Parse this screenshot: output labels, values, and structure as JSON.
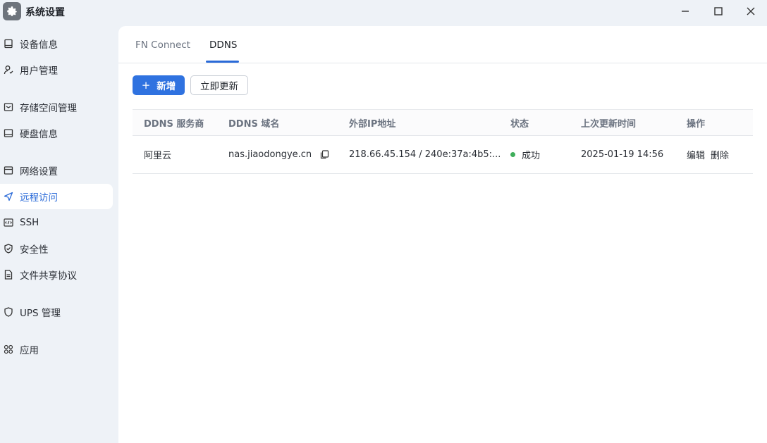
{
  "window": {
    "title": "系统设置",
    "icon": "gear-icon",
    "controls": [
      "minimize-icon",
      "maximize-icon",
      "close-icon"
    ]
  },
  "sidebar": {
    "items": [
      {
        "label": "设备信息",
        "icon": "device-icon"
      },
      {
        "label": "用户管理",
        "icon": "user-icon"
      },
      {
        "label": "存储空间管理",
        "icon": "storage-icon"
      },
      {
        "label": "硬盘信息",
        "icon": "disk-icon"
      },
      {
        "label": "网络设置",
        "icon": "network-icon"
      },
      {
        "label": "远程访问",
        "icon": "send-icon",
        "active": true
      },
      {
        "label": "SSH",
        "icon": "terminal-icon"
      },
      {
        "label": "安全性",
        "icon": "shield-check-icon"
      },
      {
        "label": "文件共享协议",
        "icon": "file-icon"
      },
      {
        "label": "UPS 管理",
        "icon": "shield-icon"
      },
      {
        "label": "应用",
        "icon": "apps-icon"
      }
    ]
  },
  "tabs": [
    {
      "label": "FN Connect"
    },
    {
      "label": "DDNS",
      "active": true
    }
  ],
  "toolbar": {
    "add_label": "新增",
    "update_label": "立即更新"
  },
  "table": {
    "columns": [
      "DDNS 服务商",
      "DDNS 域名",
      "外部IP地址",
      "状态",
      "上次更新时间",
      "操作"
    ],
    "rows": [
      {
        "provider": "阿里云",
        "domain": "nas.jiaodongye.cn",
        "ip": "218.66.45.154 / 240e:37a:4b5:...",
        "status": "成功",
        "status_color": "#3fae5b",
        "updated": "2025-01-19 14:56",
        "actions": [
          "编辑",
          "删除"
        ]
      }
    ]
  },
  "colors": {
    "accent": "#2f72e0",
    "sidebar_bg": "#eef2f7",
    "success": "#3fae5b"
  }
}
